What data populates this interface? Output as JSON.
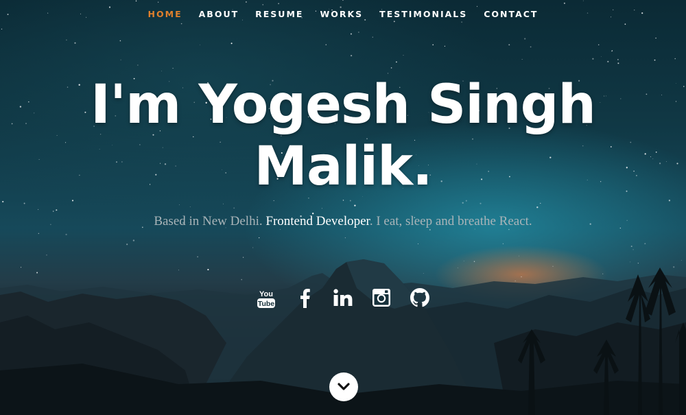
{
  "nav": {
    "items": [
      {
        "label": "HOME",
        "active": true
      },
      {
        "label": "ABOUT",
        "active": false
      },
      {
        "label": "RESUME",
        "active": false
      },
      {
        "label": "WORKS",
        "active": false
      },
      {
        "label": "TESTIMONIALS",
        "active": false
      },
      {
        "label": "CONTACT",
        "active": false
      }
    ],
    "active_color": "#e0802c",
    "color": "#ffffff"
  },
  "hero": {
    "headline_line1": "I'm Yogesh Singh",
    "headline_line2": "Malik.",
    "tagline_prefix": "Based in New Delhi. ",
    "tagline_highlight": "Frontend Developer",
    "tagline_suffix": ". I eat, sleep and breathe React."
  },
  "social": [
    {
      "name": "YouTube",
      "icon": "youtube-icon"
    },
    {
      "name": "Facebook",
      "icon": "facebook-icon"
    },
    {
      "name": "LinkedIn",
      "icon": "linkedin-icon"
    },
    {
      "name": "Instagram",
      "icon": "instagram-icon"
    },
    {
      "name": "GitHub",
      "icon": "github-icon"
    }
  ],
  "scroll_button": {
    "icon": "chevron-down-icon"
  }
}
